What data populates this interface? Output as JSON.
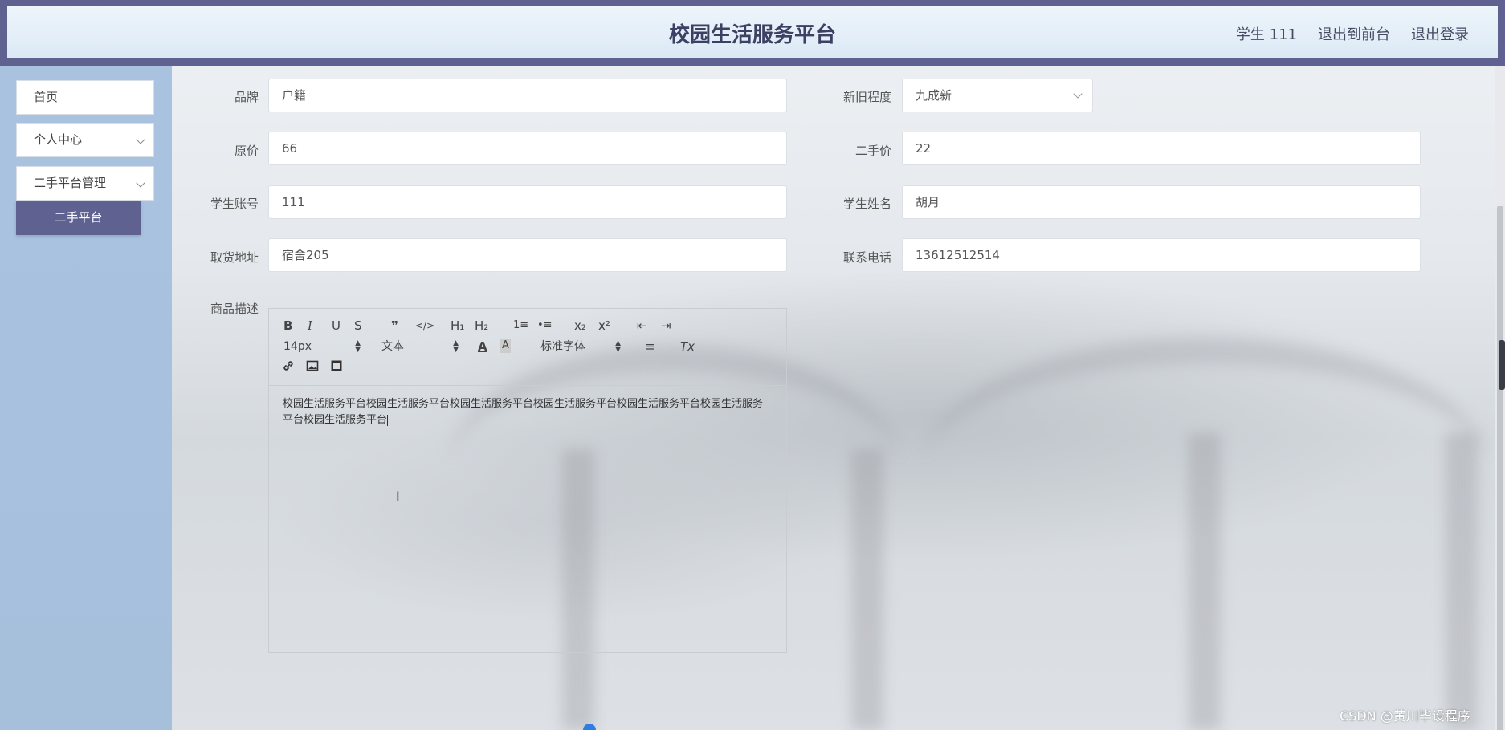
{
  "header": {
    "title": "校园生活服务平台",
    "user_label": "学生 111",
    "back_to_front": "退出到前台",
    "logout": "退出登录"
  },
  "sidebar": {
    "items": [
      {
        "label": "首页"
      },
      {
        "label": "个人中心"
      },
      {
        "label": "二手平台管理"
      }
    ],
    "active_subitem": "二手平台"
  },
  "form": {
    "brand": {
      "label": "品牌",
      "value": "户籍"
    },
    "condition": {
      "label": "新旧程度",
      "value": "九成新"
    },
    "original_price": {
      "label": "原价",
      "value": "66"
    },
    "used_price": {
      "label": "二手价",
      "value": "22"
    },
    "student_account": {
      "label": "学生账号",
      "value": "111"
    },
    "student_name": {
      "label": "学生姓名",
      "value": "胡月"
    },
    "pickup_address": {
      "label": "取货地址",
      "value": "宿舍205"
    },
    "phone": {
      "label": "联系电话",
      "value": "13612512514"
    },
    "description": {
      "label": "商品描述",
      "text": "校园生活服务平台校园生活服务平台校园生活服务平台校园生活服务平台校园生活服务平台校园生活服务平台校园生活服务平台"
    }
  },
  "editor_toolbar": {
    "bold": "B",
    "italic": "I",
    "underline": "U",
    "strike": "S",
    "quote": "❞",
    "code": "</>",
    "h1": "H₁",
    "h2": "H₂",
    "ordered_list": "1≡",
    "bullet_list": "•≡",
    "subscript": "x₂",
    "superscript": "x²",
    "outdent": "⇤",
    "indent": "⇥",
    "font_size": "14px",
    "block_type": "文本",
    "font_family": "标准字体",
    "clean": "Tx"
  },
  "watermark": "CSDN @黄川毕设程序"
}
